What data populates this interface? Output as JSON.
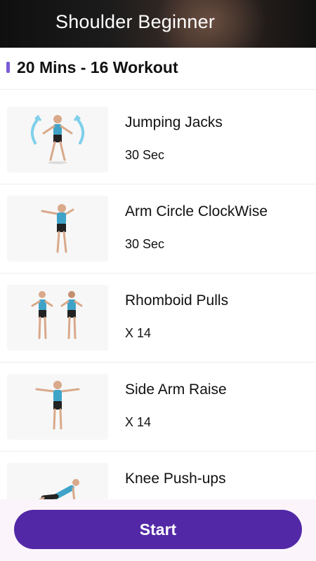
{
  "header": {
    "title": "Shoulder Beginner"
  },
  "summary": {
    "text": "20 Mins - 16 Workout",
    "accent_color": "#7b5cd6"
  },
  "exercises": [
    {
      "name": "Jumping Jacks",
      "amount": "30 Sec",
      "icon": "jumping-jacks-figure"
    },
    {
      "name": "Arm Circle ClockWise",
      "amount": "30 Sec",
      "icon": "arm-circle-figure"
    },
    {
      "name": "Rhomboid Pulls",
      "amount": "X 14",
      "icon": "rhomboid-pulls-figure"
    },
    {
      "name": "Side Arm Raise",
      "amount": "X 14",
      "icon": "side-arm-raise-figure"
    },
    {
      "name": "Knee Push-ups",
      "amount": "",
      "icon": "knee-pushups-figure"
    }
  ],
  "footer": {
    "start_label": "Start",
    "button_color": "#5228a6"
  }
}
